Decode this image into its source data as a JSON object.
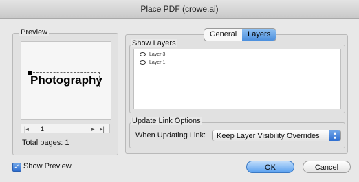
{
  "window": {
    "title": "Place PDF (crowe.ai)"
  },
  "preview": {
    "label": "Preview",
    "thumbnail_text": "Photography",
    "pager": {
      "first": "|◂",
      "prev": "◂",
      "page": "1",
      "next": "▸",
      "last": "▸|"
    },
    "total_pages": "Total pages: 1",
    "show_preview_label": "Show Preview",
    "show_preview_checked": true
  },
  "tabs": [
    {
      "label": "General",
      "active": false
    },
    {
      "label": "Layers",
      "active": true
    }
  ],
  "layers": {
    "label": "Show Layers",
    "items": [
      {
        "name": "Layer 3",
        "icon": "eye-icon"
      },
      {
        "name": "Layer 1",
        "icon": "eye-icon"
      }
    ]
  },
  "update_link": {
    "label": "Update Link Options",
    "field_label": "When Updating Link:",
    "selected": "Keep Layer Visibility Overrides"
  },
  "buttons": {
    "ok": "OK",
    "cancel": "Cancel"
  }
}
